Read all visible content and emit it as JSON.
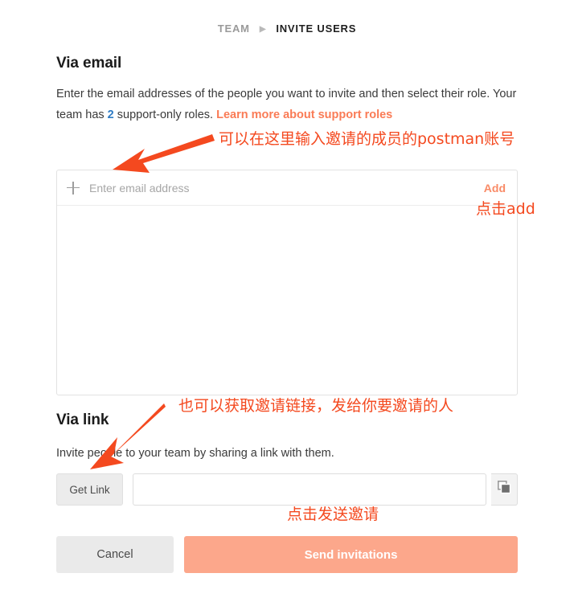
{
  "breadcrumb": {
    "parent": "TEAM",
    "separator": "▶",
    "current": "INVITE USERS"
  },
  "via_email": {
    "title": "Via email",
    "description_part1": "Enter the email addresses of the people you want to invite and then select their role. Your team has ",
    "roles_count": "2",
    "description_part2": " support-only roles. ",
    "learn_more_link": "Learn more about support roles",
    "input_placeholder": "Enter email address",
    "input_value": "",
    "plus_icon": "plus-icon",
    "add_label": "Add"
  },
  "via_link": {
    "title": "Via link",
    "description": "Invite people to your team by sharing a link with them.",
    "get_link_label": "Get Link",
    "link_value": "",
    "link_placeholder": "",
    "copy_icon": "copy-icon"
  },
  "footer": {
    "cancel_label": "Cancel",
    "send_label": "Send invitations"
  },
  "annotations": {
    "email_note": "可以在这里输入邀请的成员的postman账号",
    "add_note": "点击add",
    "link_note": "也可以获取邀请链接，发给你要邀请的人",
    "send_note": "点击发送邀请"
  },
  "colors": {
    "annotation_red": "#f4491f",
    "accent_orange": "#fa7b55",
    "add_orange": "#f98b67",
    "primary_button": "#fca78b",
    "link_blue": "#2e7bc4",
    "cancel_gray": "#eaeaea"
  }
}
